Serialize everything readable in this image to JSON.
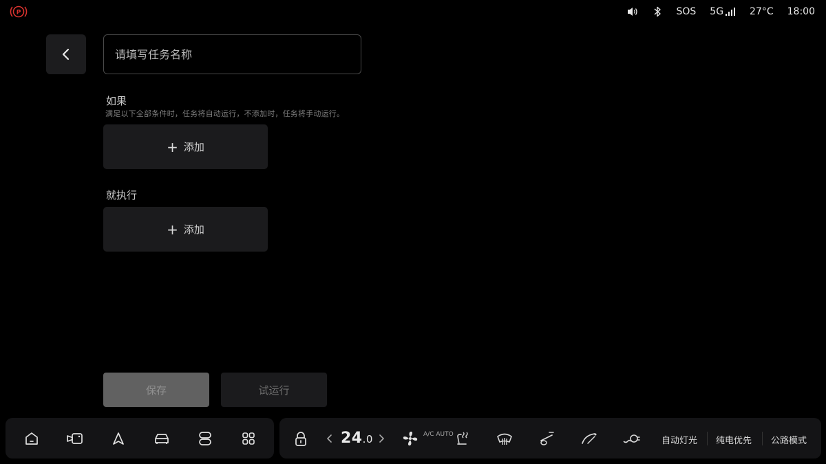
{
  "status_bar": {
    "parking_icon": "parking-brake-icon",
    "volume_icon": "volume-icon",
    "bluetooth_icon": "bluetooth-icon",
    "sos": "SOS",
    "network": "5G",
    "temperature": "27°C",
    "time": "18:00",
    "colors": {
      "parking": "#d8322e"
    }
  },
  "header": {
    "back_icon": "chevron-left-icon",
    "task_name_placeholder": "请填写任务名称",
    "task_name_value": ""
  },
  "condition": {
    "title": "如果",
    "description": "满足以下全部条件时，任务将自动运行，不添加时，任务将手动运行。",
    "add_label": "添加"
  },
  "action": {
    "title": "就执行",
    "add_label": "添加"
  },
  "buttons": {
    "save_label": "保存",
    "trial_label": "试运行"
  },
  "dock": {
    "left_icons": [
      "home-icon",
      "camera-icon",
      "navigation-icon",
      "car-icon",
      "switch-icon",
      "apps-grid-icon"
    ],
    "lock_icon": "lock-icon",
    "temperature_int": "24",
    "temperature_dec": ".0",
    "ac_label": "A/C",
    "auto_label": "AUTO",
    "right_texts": [
      "自动灯光",
      "纯电优先",
      "公路模式"
    ]
  }
}
